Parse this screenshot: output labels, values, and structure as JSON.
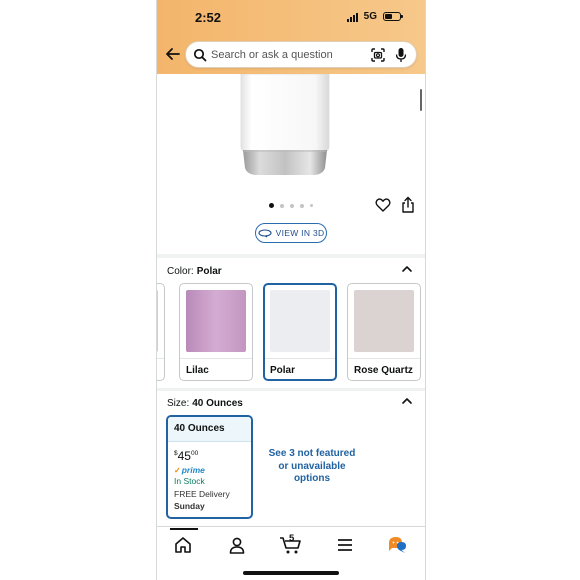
{
  "status_bar": {
    "time": "2:52",
    "network": "5G"
  },
  "search": {
    "placeholder": "Search or ask a question"
  },
  "gallery": {
    "image_count": 5,
    "active_index": 0
  },
  "view_3d": {
    "label": "VIEW IN 3D"
  },
  "color_section": {
    "label": "Color:",
    "selected": "Polar",
    "swatches": [
      {
        "name": "Lilac",
        "color": "#c79ac7"
      },
      {
        "name": "Polar",
        "color": "#ecedf0"
      },
      {
        "name": "Rose Quartz",
        "color": "#dbd3d1"
      }
    ]
  },
  "size_section": {
    "label": "Size:",
    "selected": "40 Ounces",
    "option": {
      "name": "40 Ounces",
      "price_symbol": "$",
      "price_whole": "45",
      "price_fraction": "00",
      "prime_label": "prime",
      "stock": "In Stock",
      "delivery": "FREE Delivery",
      "delivery_day": "Sunday"
    },
    "see_more": "See 3 not featured or unavailable options"
  },
  "tab_bar": {
    "cart_count": "5",
    "items": [
      "home-icon",
      "account-icon",
      "cart-icon",
      "menu-icon",
      "rufus-icon"
    ]
  },
  "colors": {
    "header": "#f6c88a",
    "link_blue": "#2162a1",
    "in_stock_green": "#067D62",
    "prime_blue": "#1f8ac9"
  }
}
